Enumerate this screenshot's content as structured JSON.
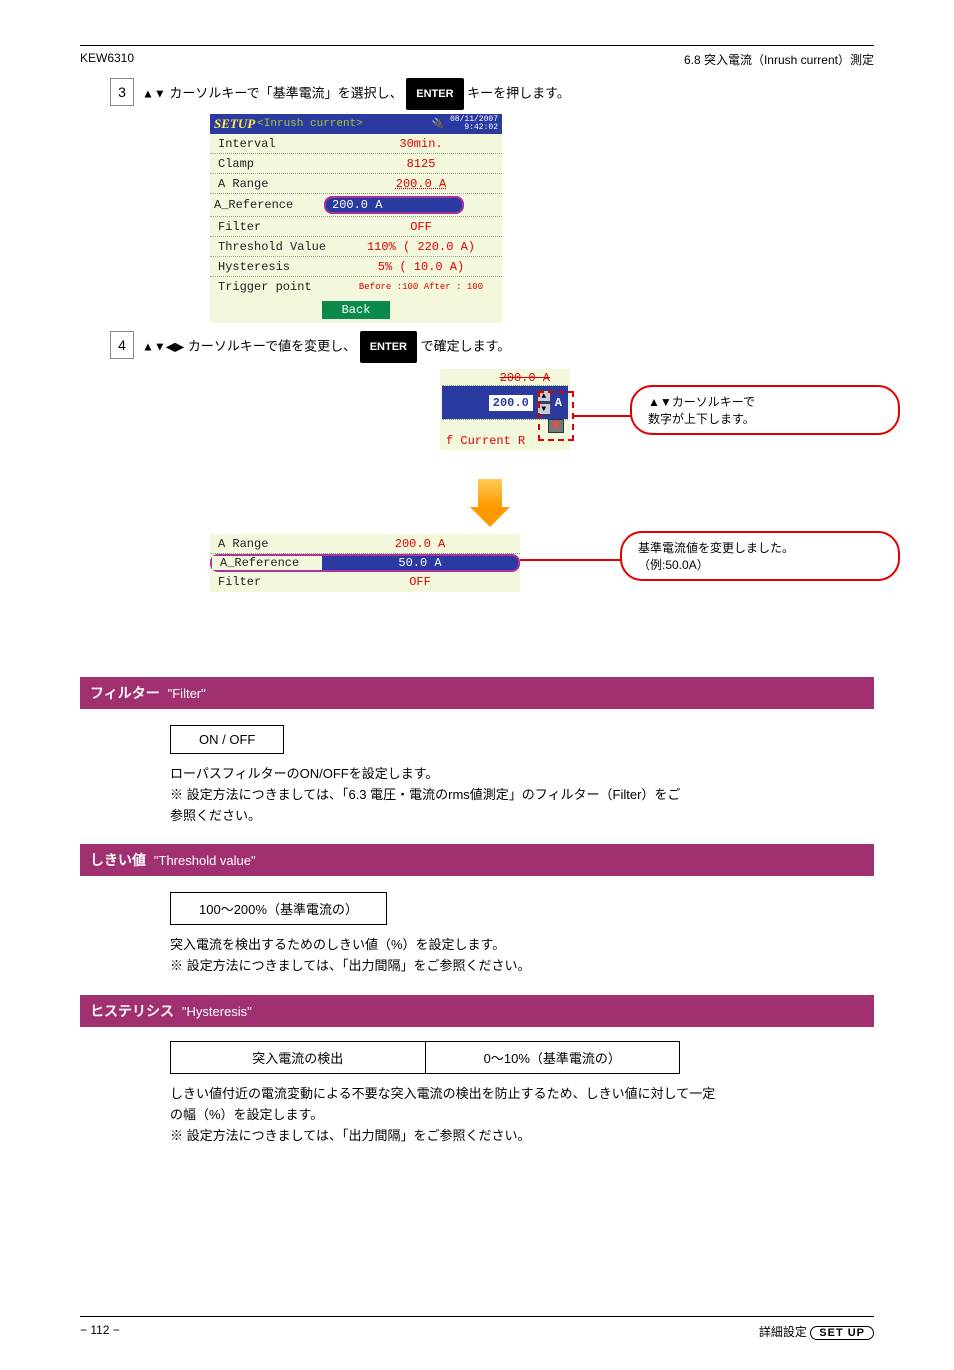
{
  "header": {
    "left": "KEW6310",
    "right": "6.8 突入電流（Inrush current）測定"
  },
  "steps": {
    "s3_pre": "3",
    "s3_text_a": "カーソルキーで「基準電流」を選択し、",
    "s3_enter": "ENTER",
    "s3_text_b": "キーを押します。",
    "s4_pre": "4",
    "s4_text_a": "カーソルキーで値を変更し、",
    "s4_enter": "ENTER",
    "s4_text_b": "で確定します。"
  },
  "screenshot": {
    "setup_word": "SETUP",
    "title_sub": "<Inrush current>",
    "datetime_l1": "08/11/2007",
    "datetime_l2": "9:42:02",
    "rows": {
      "interval": {
        "label": "Interval",
        "value": "30min."
      },
      "clamp": {
        "label": "Clamp",
        "value": "8125"
      },
      "arange": {
        "label": "A Range",
        "value": "200.0 A"
      },
      "aref": {
        "label": "A_Reference",
        "value": "200.0 A"
      },
      "filter": {
        "label": "Filter",
        "value": "OFF"
      },
      "threshold": {
        "label": "Threshold Value",
        "value": "110%  ( 220.0 A)"
      },
      "hyst": {
        "label": "Hysteresis",
        "value": "5%  (  10.0 A)"
      },
      "trigger": {
        "label": "Trigger point",
        "value_left": "Before :100",
        "value_right": "After :  100"
      }
    },
    "back": "Back"
  },
  "spinner": {
    "top": "200.0 A",
    "value": "200.0",
    "unit": "A",
    "bottom": "f  Current  R"
  },
  "callout1": {
    "l1": "▲▼カーソルキーで",
    "l2": "数字が上下します。"
  },
  "callout2": {
    "l1": "基準電流値を変更しました。",
    "l2": "（例:50.0A）"
  },
  "after": {
    "arange": {
      "label": "A Range",
      "value": "200.0 A"
    },
    "aref": {
      "label": "A_Reference",
      "value": "50.0 A"
    },
    "filter": {
      "label": "Filter",
      "value": "OFF"
    }
  },
  "sec_filter": {
    "title_jp": "フィルター",
    "title_en": "\"Filter\"",
    "box": "ON / OFF",
    "body1": "ローパスフィルターのON/OFFを設定します。",
    "body2": "※ 設定方法につきましては、「6.3 電圧・電流のrms値測定」のフィルター（Filter）をご",
    "body3": "参照ください。"
  },
  "sec_threshold": {
    "title_jp": "しきい値",
    "title_en": "\"Threshold value\"",
    "box": "100～200%（基準電流の）",
    "body1": "突入電流を検出するためのしきい値（%）を設定します。",
    "body2": "※ 設定方法につきましては、「出力間隔」をご参照ください。"
  },
  "sec_hyst": {
    "title_jp": "ヒステリシス",
    "title_en": "\"Hysteresis\"",
    "box_left": "突入電流の検出",
    "box_right": "0～10%（基準電流の）",
    "body1": "しきい値付近の電流変動による不要な突入電流の検出を防止するため、しきい値に対して一定",
    "body2": "の幅（%）を設定します。",
    "body3": "※ 設定方法につきましては、「出力間隔」をご参照ください。"
  },
  "footer": {
    "left": "− 112 −",
    "right_pre": "詳細設定",
    "pill": "SET UP"
  }
}
